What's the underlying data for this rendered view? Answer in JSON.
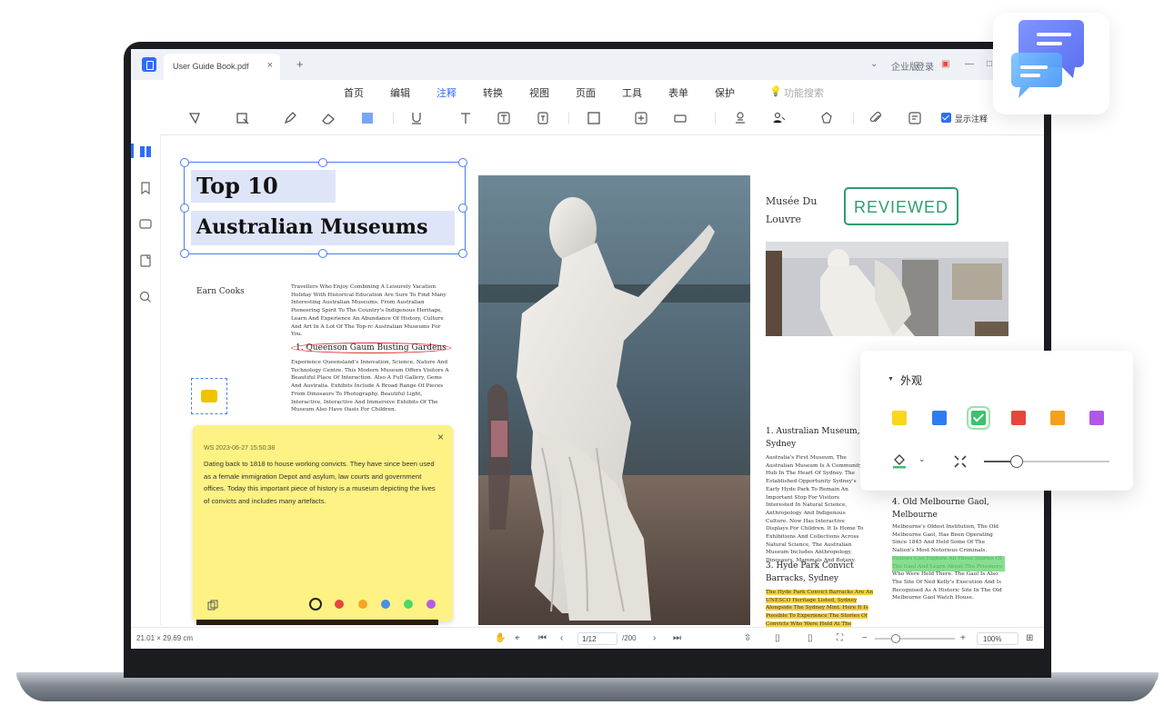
{
  "window": {
    "tab_title": "User Guide Book.pdf",
    "tab_close": "×",
    "new_tab": "+",
    "controls": [
      "⌄",
      "企业版",
      "登录",
      "▣",
      "—",
      "□",
      "×"
    ]
  },
  "menu": {
    "items": [
      {
        "label": "首页",
        "active": false
      },
      {
        "label": "编辑",
        "active": false
      },
      {
        "label": "注释",
        "active": true
      },
      {
        "label": "转换",
        "active": false
      },
      {
        "label": "视图",
        "active": false
      },
      {
        "label": "页面",
        "active": false
      },
      {
        "label": "工具",
        "active": false
      },
      {
        "label": "表单",
        "active": false
      },
      {
        "label": "保护",
        "active": false
      }
    ],
    "search_placeholder": "功能搜索"
  },
  "toolbar": {
    "show_annotations_label": "显示注释",
    "show_annotations_checked": true
  },
  "document": {
    "title_line1": "Top 10",
    "title_line2": "Australian Museums",
    "author": "Earn Cooks",
    "intro": "Travellers Who Enjoy Combining A Leisurely Vacation Holiday With Historical Education Are Sure To Find Many Interesting Australian Museums. From Australian Pioneering Spirit To The Country's Indigenous Heritage, Learn And Experience An Abundance Of History, Culture And Art In A Lot Of The Top-rc Australian Museums For You.",
    "section1_title": "1. Queenson Gaum Busting Gardens",
    "section1_body": "Experience Queensland's Innovation, Science, Nature And Technology Centre. This Modern Museum Offers Visitors A Beautiful Place Of Interaction. Also A Full Gallery, Gems And Australia. Exhibits Include A Broad Range Of Pieces From Dinosaurs To Photography. Beautiful Light, Interactive, Interactive And Immersive Exhibits Of The Museum Also Have Oasis For Children.",
    "sticky_meta": "WS  2023-06-27 15:50:38",
    "sticky_body": "Dating back to 1818 to house working convicts. They have since been used as a female immigration Depot and asylum, law courts and government offices. Today this important piece of history is a museum depicting the lives of convicts and includes many artefacts.",
    "sticky_close": "×",
    "sticky_colors": [
      "#fdf283",
      "#e8453c",
      "#f5a623",
      "#4a90e2",
      "#4cd964",
      "#b55ce6"
    ],
    "right_heading": "Musée Du Louvre",
    "stamp": "REVIEWED",
    "section2_title": "1. Australian Museum, Sydney",
    "section2_body": "Australia's First Museum, The Australian Museum Is A Community Hub In The Heart Of Sydney. The Established Opportunity Sydney's Early Hyde Park To Remain An Important Stop For Visitors Interested In Natural Science, Anthropology And Indigenous Culture. Now Has Interactive Displays For Children. It Is Home To Exhibitions And Collections Across Natural Science, The Australian Museum Includes Anthropology, Dinosaurs, Mammals And Botany.",
    "section3_title": "3. Hyde Park Convict Barracks, Sydney",
    "section3_body": "The Hyde Park Convict Barracks Are An UNESCO Heritage Listed, Sydney Alongside The Sydney Mint. Here It Is Possible To Experience The Stories Of Convicts Who Were Held At The Barracks.",
    "section4_title": "4. Old Melbourne Gaol, Melbourne",
    "section4_body": "Melbourne's Oldest Institution, The Old Melbourne Gaol, Has Been Operating Since 1845 And Held Some Of The Nation's Most Notorious Criminals. Visitors Can Explore All Three Stories Of The Gaol And Learn About The Prisoners Who Were Held There. The Gaol Is Also The Site Of Ned Kelly's Execution And Is Recognised As A Historic Site In The Old Melbourne Gaol Watch House."
  },
  "statusbar": {
    "page_size": "21.01 × 29.69 cm",
    "page_current": "1/12",
    "page_total": "/200",
    "zoom": "100%",
    "zoom_level": 0.25
  },
  "appearance_panel": {
    "title": "外观",
    "colors": [
      "#f9d81b",
      "#2f7bf0",
      "#3cc26b",
      "#e8453c",
      "#f5a01d",
      "#b157e8"
    ],
    "selected_index": 2,
    "opacity_level": 0.25
  },
  "colors": {
    "accent": "#2f6df6",
    "reviewed_green": "#2e9d6e",
    "sticky_yellow": "#fdf283",
    "highlight_yellow": "#f4d03f",
    "highlight_green": "#5fd36b"
  }
}
